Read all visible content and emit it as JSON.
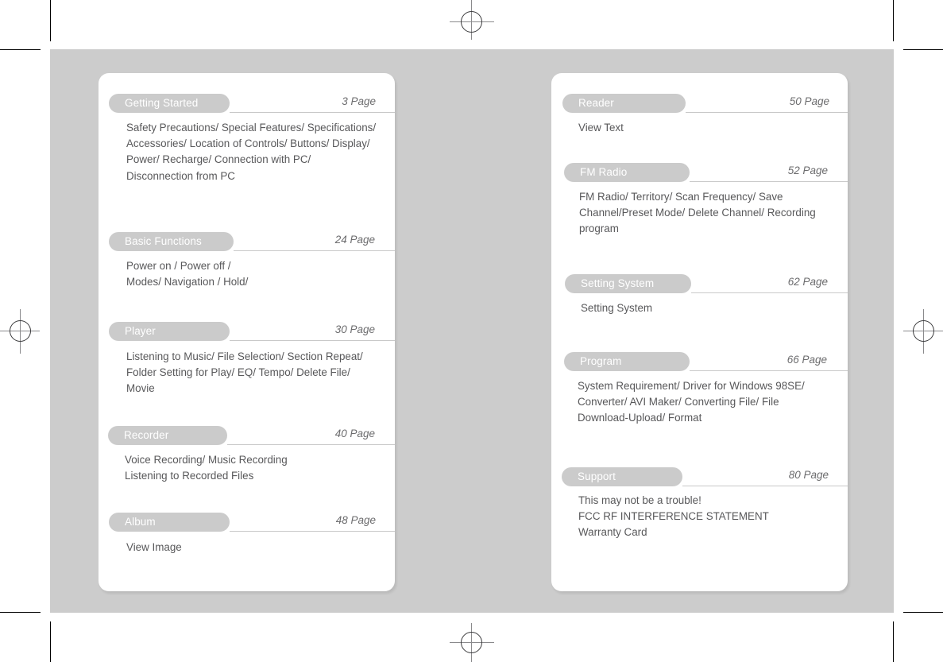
{
  "document": {
    "kind": "table-of-contents-spread",
    "background_color": "#cccccc",
    "card_color": "#ffffff",
    "pill_color": "#cbcbcb",
    "pill_text_color": "#ffffff",
    "body_text_color": "#58585a",
    "page_label_color": "#6c6c6e",
    "page_word": "Page"
  },
  "left_page": {
    "sections": [
      {
        "title": "Getting Started",
        "page": "3 Page",
        "body": "Safety Precautions/ Special Features/ Specifications/\nAccessories/ Location of Controls/ Buttons/ Display/\nPower/ Recharge/ Connection with PC/\nDisconnection from PC"
      },
      {
        "title": "Basic Functions",
        "page": "24 Page",
        "body": "Power on / Power off /\n Modes/ Navigation / Hold/"
      },
      {
        "title": "Player",
        "page": "30 Page",
        "body": "Listening to Music/ File Selection/ Section Repeat/\nFolder Setting for Play/ EQ/ Tempo/ Delete File/\nMovie"
      },
      {
        "title": "Recorder",
        "page": "40 Page",
        "body": "Voice Recording/ Music Recording\nListening to Recorded Files"
      },
      {
        "title": "Album",
        "page": "48 Page",
        "body": "View Image"
      }
    ]
  },
  "right_page": {
    "sections": [
      {
        "title": "Reader",
        "page": "50 Page",
        "body": "View Text"
      },
      {
        "title": "FM Radio",
        "page": "52 Page",
        "body": "FM Radio/ Territory/ Scan Frequency/ Save\nChannel/Preset Mode/ Delete Channel/ Recording\nprogram"
      },
      {
        "title": "Setting System",
        "page": "62 Page",
        "body": "Setting System"
      },
      {
        "title": "Program",
        "page": "66 Page",
        "body": "System Requirement/ Driver for Windows 98SE/\nConverter/ AVI Maker/ Converting File/ File\nDownload-Upload/ Format"
      },
      {
        "title": "Support",
        "page": "80 Page",
        "body": "This may not be a trouble!\nFCC RF INTERFERENCE STATEMENT\nWarranty Card"
      }
    ]
  },
  "print_marks": {
    "registration_marks": [
      "top-center",
      "left-middle",
      "right-middle",
      "bottom-center"
    ],
    "corner_crop_marks": [
      "top-left",
      "top-right",
      "bottom-left",
      "bottom-right"
    ]
  }
}
